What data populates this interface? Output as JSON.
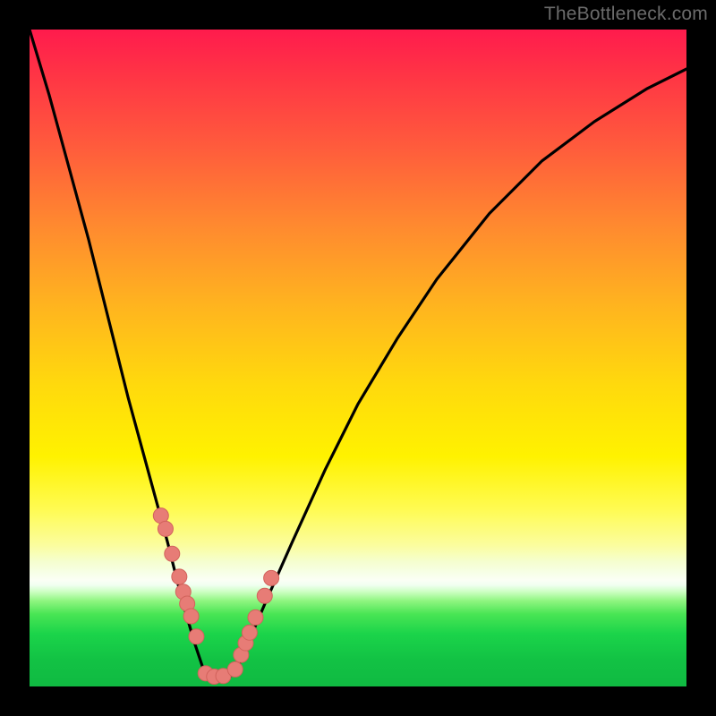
{
  "attribution": "TheBottleneck.com",
  "colors": {
    "frame": "#000000",
    "curve_stroke": "#000000",
    "marker_fill": "#e77c76",
    "marker_stroke": "#d2635c"
  },
  "chart_data": {
    "type": "line",
    "title": "",
    "xlabel": "",
    "ylabel": "",
    "xlim": [
      0,
      100
    ],
    "ylim": [
      0,
      100
    ],
    "grid": false,
    "legend": false,
    "notes": "No axes, ticks, titles, or legend are visible. The background gradient encodes value (top=red high, bottom=green low). A black V-shaped performance curve dips to ~0 near x≈26–30, with scattered pink data markers clustered along the lower part of the V.",
    "series": [
      {
        "name": "curve",
        "kind": "line",
        "x": [
          0,
          3,
          6,
          9,
          12,
          15,
          18,
          21,
          23,
          25,
          26.5,
          28,
          30,
          31.5,
          33,
          36,
          40,
          45,
          50,
          56,
          62,
          70,
          78,
          86,
          94,
          100
        ],
        "y": [
          100,
          90,
          79,
          68,
          56,
          44,
          33,
          22,
          14,
          7,
          2.5,
          1,
          1,
          2.5,
          6,
          13,
          22,
          33,
          43,
          53,
          62,
          72,
          80,
          86,
          91,
          94
        ]
      },
      {
        "name": "markers",
        "kind": "scatter",
        "x": [
          20.0,
          20.7,
          21.7,
          22.8,
          23.4,
          24.0,
          24.6,
          25.4,
          26.8,
          28.1,
          29.5,
          31.3,
          32.2,
          32.9,
          33.5,
          34.4,
          35.8,
          36.8
        ],
        "y": [
          26.0,
          24.0,
          20.2,
          16.7,
          14.4,
          12.6,
          10.7,
          7.6,
          2.0,
          1.5,
          1.6,
          2.6,
          4.8,
          6.6,
          8.2,
          10.5,
          13.8,
          16.5
        ]
      }
    ]
  }
}
